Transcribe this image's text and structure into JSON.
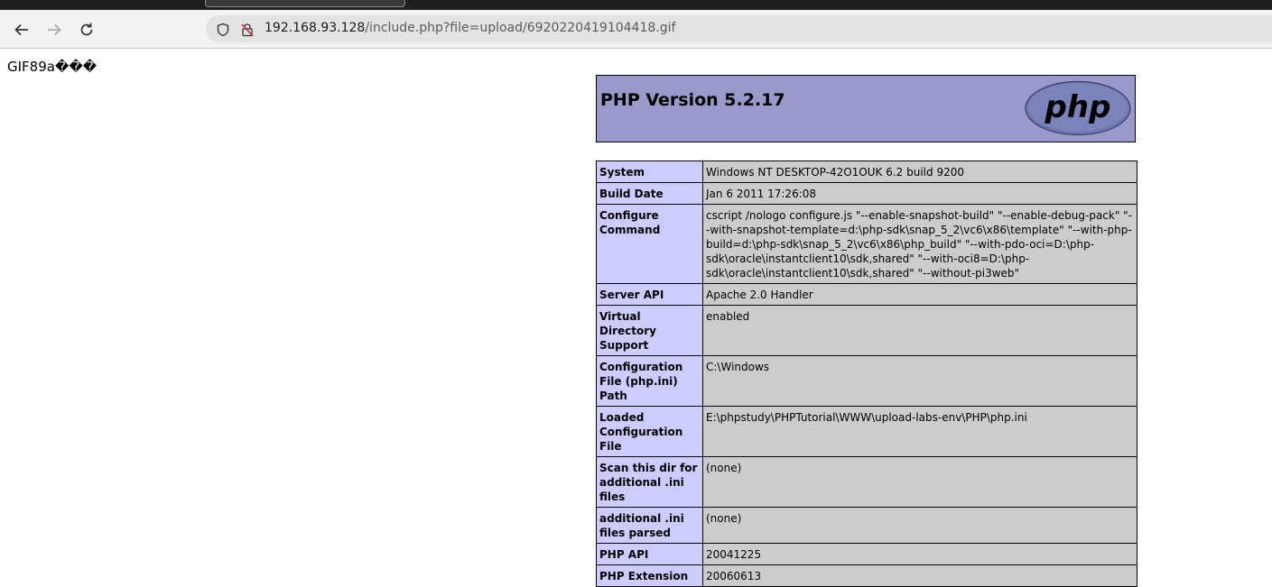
{
  "browser": {
    "url_host": "192.168.93.128",
    "url_path": "/include.php?file=upload/6920220419104418.gif"
  },
  "page": {
    "gif_header": "GIF89a���",
    "php_version_title": "PHP Version 5.2.17",
    "logo_text": "php",
    "rows": [
      {
        "label": "System",
        "value": "Windows NT DESKTOP-42O1OUK 6.2 build 9200"
      },
      {
        "label": "Build Date",
        "value": "Jan 6 2011 17:26:08"
      },
      {
        "label": "Configure Command",
        "value": "cscript /nologo configure.js \"--enable-snapshot-build\" \"--enable-debug-pack\" \"--with-snapshot-template=d:\\php-sdk\\snap_5_2\\vc6\\x86\\template\" \"--with-php-build=d:\\php-sdk\\snap_5_2\\vc6\\x86\\php_build\" \"--with-pdo-oci=D:\\php-sdk\\oracle\\instantclient10\\sdk,shared\" \"--with-oci8=D:\\php-sdk\\oracle\\instantclient10\\sdk,shared\" \"--without-pi3web\""
      },
      {
        "label": "Server API",
        "value": "Apache 2.0 Handler"
      },
      {
        "label": "Virtual Directory Support",
        "value": "enabled"
      },
      {
        "label": "Configuration File (php.ini) Path",
        "value": "C:\\Windows"
      },
      {
        "label": "Loaded Configuration File",
        "value": "E:\\phpstudy\\PHPTutorial\\WWW\\upload-labs-env\\PHP\\php.ini"
      },
      {
        "label": "Scan this dir for additional .ini files",
        "value": "(none)"
      },
      {
        "label": "additional .ini files parsed",
        "value": "(none)"
      },
      {
        "label": "PHP API",
        "value": "20041225"
      },
      {
        "label": "PHP Extension",
        "value": "20060613"
      }
    ]
  },
  "colors": {
    "header_bg": "#9999cc",
    "label_bg": "#ccccff",
    "value_bg": "#cccccc"
  }
}
